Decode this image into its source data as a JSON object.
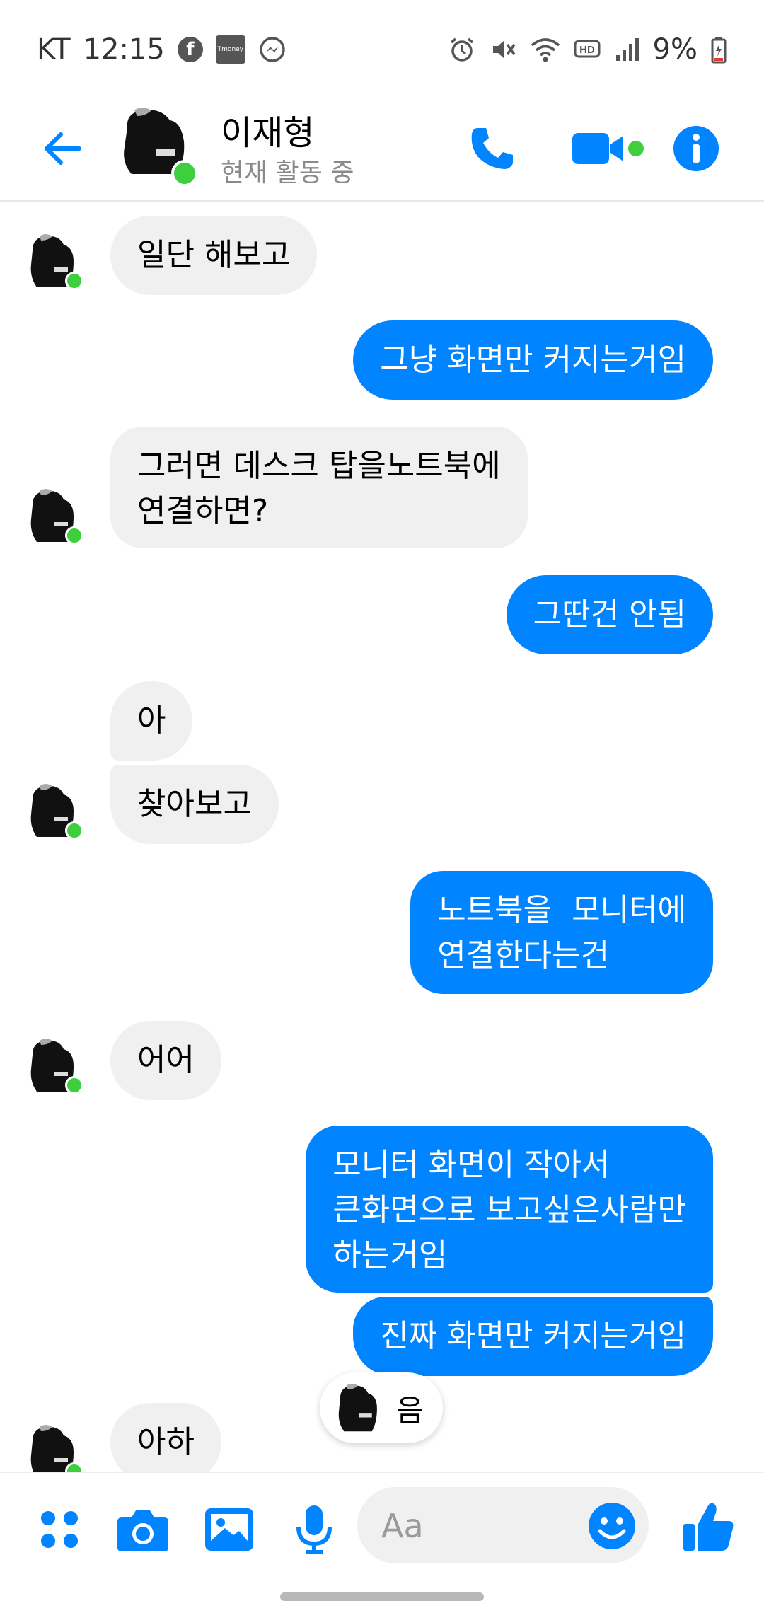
{
  "status_bar": {
    "carrier": "KT",
    "time": "12:15",
    "tmoney_label": "Tmoney",
    "battery": "9%"
  },
  "header": {
    "contact_name": "이재형",
    "contact_status": "현재 활동 중"
  },
  "messages": [
    {
      "side": "in",
      "text": "일단 해보고"
    },
    {
      "side": "out",
      "text": "그냥 화면만 커지는거임"
    },
    {
      "side": "in",
      "text": "그러면 데스크 탑을노트북에\n연결하면?"
    },
    {
      "side": "out",
      "text": "그딴건 안됨"
    },
    {
      "side": "in",
      "text": "아"
    },
    {
      "side": "in",
      "text": "찾아보고"
    },
    {
      "side": "out",
      "text": "노트북을  모니터에\n연결한다는건"
    },
    {
      "side": "in",
      "text": "어어"
    },
    {
      "side": "out",
      "text": "모니터 화면이 작아서\n큰화면으로 보고싶은사람만\n하는거임"
    },
    {
      "side": "out",
      "text": "진짜 화면만 커지는거임"
    },
    {
      "side": "in",
      "text": "아하"
    }
  ],
  "reaction": {
    "text": "음"
  },
  "composer": {
    "placeholder": "Aa"
  },
  "colors": {
    "accent": "#0084ff",
    "incoming_bubble": "#f0f0f0",
    "presence": "#3dcf3d"
  },
  "icons": [
    "back-arrow-icon",
    "phone-icon",
    "video-camera-icon",
    "info-icon",
    "apps-grid-icon",
    "camera-icon",
    "gallery-icon",
    "microphone-icon",
    "emoji-icon",
    "thumbs-up-icon"
  ]
}
